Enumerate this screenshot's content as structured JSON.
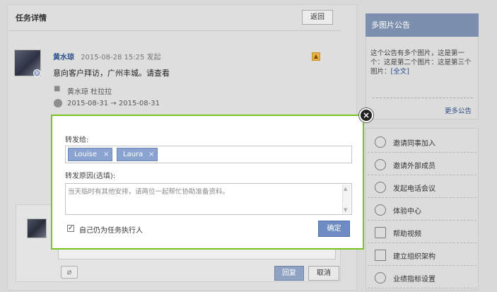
{
  "main": {
    "title": "任务详情",
    "back_label": "返回",
    "author": "黄水琼",
    "post_time": "2015-08-28 15:25 发起",
    "task_text": "意向客户拜访，广州丰城。请查看",
    "people": "黄水琼   杜拉拉",
    "date_range": "2015-08-31 → 2015-08-31",
    "reply_label": "回复",
    "cancel_label": "取消"
  },
  "sidebar": {
    "notice_title": "多图片公告",
    "notice_text": "这个公告有多个图片，这是第一个：这是第二个图片：这是第三个图片：",
    "notice_link": "[全文]",
    "more_notices": "更多公告",
    "menu": [
      {
        "label": "邀请同事加入",
        "icon": "user-add-icon"
      },
      {
        "label": "邀请外部成员",
        "icon": "user-external-icon"
      },
      {
        "label": "发起电话会议",
        "icon": "phone-icon"
      },
      {
        "label": "体验中心",
        "icon": "clover-icon"
      },
      {
        "label": "帮助视频",
        "icon": "video-icon"
      },
      {
        "label": "建立组织架构",
        "icon": "org-chart-icon"
      },
      {
        "label": "业绩指标设置",
        "icon": "timer-icon"
      }
    ]
  },
  "dialog": {
    "forward_label": "转发给:",
    "recipients": [
      "Louise",
      "Laura"
    ],
    "remove_symbol": "×",
    "reason_label": "转发原因(选填):",
    "reason_text": "当天临时有其他安排，请两位一起帮忙协助准备资料。",
    "keep_checked": true,
    "keep_label": "自己仍为任务执行人",
    "confirm_label": "确定",
    "close_symbol": "×"
  },
  "colors": {
    "accent_green": "#7cc21f",
    "token_blue": "#8aa3d1",
    "confirm_blue": "#6e8cc2",
    "header_blue": "#7d8fae"
  }
}
